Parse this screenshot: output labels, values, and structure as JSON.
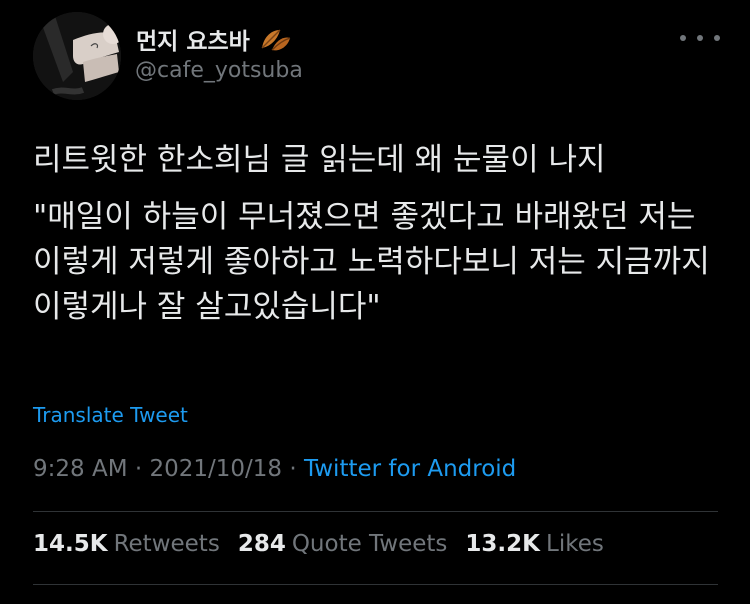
{
  "user": {
    "display_name": "먼지 요츠바",
    "handle": "@cafe_yotsuba",
    "name_emoji_icon": "fallen-leaf-icon"
  },
  "tweet": {
    "text_line1": "리트윗한 한소희님 글 읽는데 왜 눈물이 나지",
    "text_quote": "\"매일이 하늘이 무너졌으면 좋겠다고 바래왔던 저는 이렇게 저렇게 좋아하고 노력하다보니 저는 지금까지 이렇게나 잘 살고있습니다\""
  },
  "translate_label": "Translate Tweet",
  "meta": {
    "time": "9:28 AM",
    "separator": "·",
    "date": "2021/10/18",
    "source": "Twitter for Android"
  },
  "stats": {
    "retweets_count": "14.5K",
    "retweets_label": "Retweets",
    "quotes_count": "284",
    "quotes_label": "Quote Tweets",
    "likes_count": "13.2K",
    "likes_label": "Likes"
  },
  "colors": {
    "background": "#000000",
    "text_primary": "#e7e9ea",
    "text_secondary": "#71767b",
    "link": "#1d9bf0",
    "divider": "#2f3336"
  }
}
